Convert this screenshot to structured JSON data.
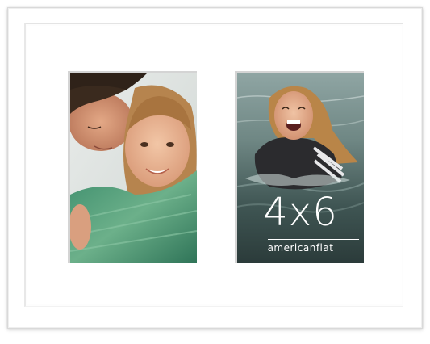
{
  "product": {
    "size_label": "4x6",
    "brand_name": "americanflat"
  },
  "colors": {
    "frame": "#ffffff",
    "mat": "#ffffff",
    "window_shadow": "#d4d4d4",
    "water": "#3d5a5c",
    "text_overlay": "#ffffff"
  },
  "photos": [
    {
      "subject": "mother-and-daughter-hug"
    },
    {
      "subject": "girl-laughing-in-water"
    }
  ]
}
